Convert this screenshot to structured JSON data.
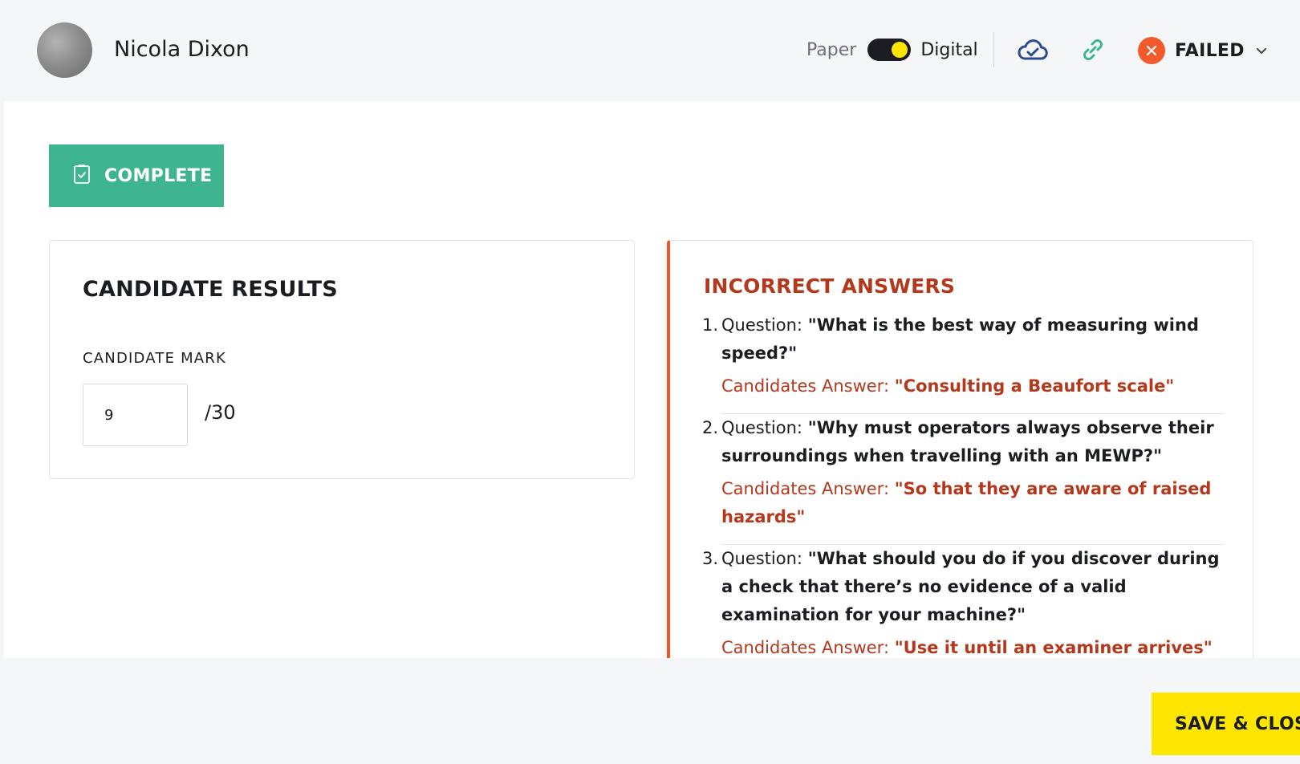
{
  "header": {
    "user_name": "Nicola Dixon",
    "mode_toggle": {
      "left_label": "Paper",
      "right_label": "Digital",
      "selected": "Digital"
    },
    "cloud_icon": "cloud-check-icon",
    "link_icon": "link-icon",
    "status": {
      "label": "FAILED",
      "icon": "close-icon",
      "color": "#f15a2b"
    }
  },
  "actions": {
    "complete_label": "COMPLETE",
    "complete_icon": "clipboard-check-icon",
    "save_close_label": "SAVE & CLOSE"
  },
  "results": {
    "title": "CANDIDATE RESULTS",
    "mark_label": "CANDIDATE MARK",
    "mark_value": "9",
    "mark_total": "/30"
  },
  "incorrect": {
    "title": "INCORRECT ANSWERS",
    "question_prefix": "Question:",
    "answer_prefix": "Candidates Answer:",
    "items": [
      {
        "num": "1.",
        "question": "\"What is the best way of measuring wind speed?\"",
        "answer": "\"Consulting a Beaufort scale\""
      },
      {
        "num": "2.",
        "question": "\"Why must operators always observe their surroundings when travelling with an MEWP?\"",
        "answer": "\"So that they are aware of raised hazards\""
      },
      {
        "num": "3.",
        "question": "\"What should you do if you discover during a check that there’s no evidence of a valid examination for your machine?\"",
        "answer": "\"Use it until an examiner arrives\""
      }
    ]
  },
  "colors": {
    "accent_green": "#3fb58f",
    "accent_yellow": "#ffe600",
    "error_red": "#b3381c",
    "error_orange": "#e8582b"
  }
}
